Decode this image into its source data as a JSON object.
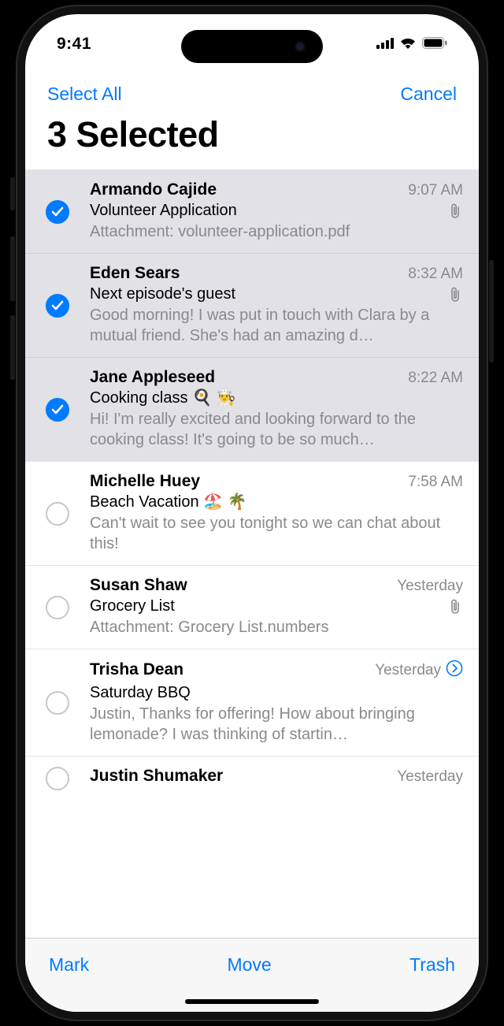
{
  "status": {
    "time": "9:41"
  },
  "nav": {
    "left": "Select All",
    "right": "Cancel"
  },
  "title": "3 Selected",
  "toolbar": {
    "mark": "Mark",
    "move": "Move",
    "trash": "Trash"
  },
  "messages": [
    {
      "sender": "Armando Cajide",
      "time": "9:07 AM",
      "subject": "Volunteer Application",
      "preview": "Attachment: volunteer-application.pdf",
      "selected": true,
      "attachment": true,
      "reply": false
    },
    {
      "sender": "Eden Sears",
      "time": "8:32 AM",
      "subject": "Next episode's guest",
      "preview": "Good morning! I was put in touch with Clara by a mutual friend. She's had an amazing d…",
      "selected": true,
      "attachment": true,
      "reply": false
    },
    {
      "sender": "Jane Appleseed",
      "time": "8:22 AM",
      "subject": "Cooking class 🍳 👨‍🍳",
      "preview": "Hi! I'm really excited and looking forward to the cooking class! It's going to be so much…",
      "selected": true,
      "attachment": false,
      "reply": false
    },
    {
      "sender": "Michelle Huey",
      "time": "7:58 AM",
      "subject": "Beach Vacation 🏖️ 🌴",
      "preview": "Can't wait to see you tonight so we can chat about this!",
      "selected": false,
      "attachment": false,
      "reply": false
    },
    {
      "sender": "Susan Shaw",
      "time": "Yesterday",
      "subject": "Grocery List",
      "preview": "Attachment: Grocery List.numbers",
      "selected": false,
      "attachment": true,
      "reply": false
    },
    {
      "sender": "Trisha Dean",
      "time": "Yesterday",
      "subject": "Saturday BBQ",
      "preview": "Justin, Thanks for offering! How about bringing lemonade? I was thinking of startin…",
      "selected": false,
      "attachment": false,
      "reply": true
    },
    {
      "sender": "Justin Shumaker",
      "time": "Yesterday",
      "subject": "",
      "preview": "",
      "selected": false,
      "attachment": false,
      "reply": false
    }
  ]
}
